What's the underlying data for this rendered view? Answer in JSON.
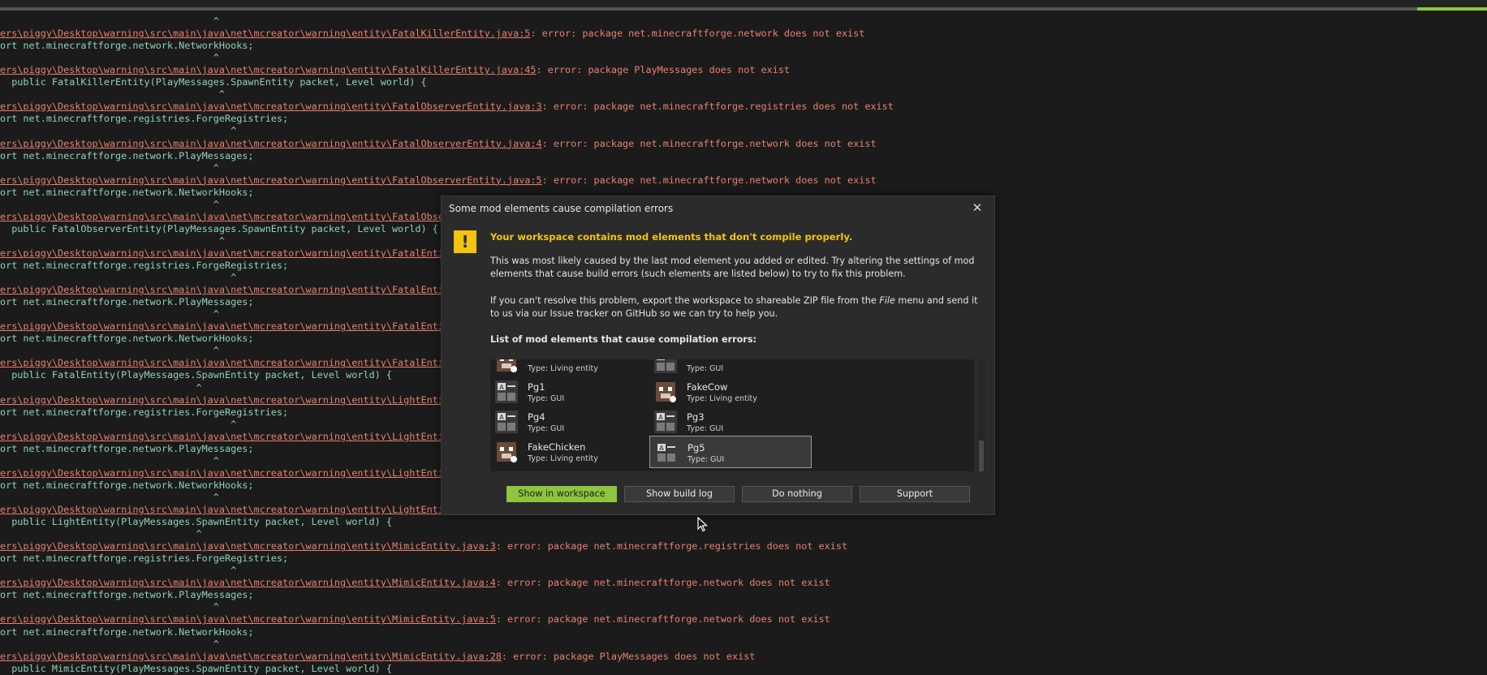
{
  "console": {
    "lines": [
      {
        "type": "caret",
        "text": "                                     ^"
      },
      {
        "type": "err",
        "path": "ers\\piggy\\Desktop\\warning\\src\\main\\java\\net\\mcreator\\warning\\entity\\FatalKillerEntity.java:5",
        "msg": ": error: package net.minecraftforge.network does not exist"
      },
      {
        "type": "code",
        "text": "ort net.minecraftforge.network.NetworkHooks;"
      },
      {
        "type": "caret",
        "text": "                                     ^"
      },
      {
        "type": "err",
        "path": "ers\\piggy\\Desktop\\warning\\src\\main\\java\\net\\mcreator\\warning\\entity\\FatalKillerEntity.java:45",
        "msg": ": error: package PlayMessages does not exist"
      },
      {
        "type": "code",
        "text": "  public FatalKillerEntity(PlayMessages.SpawnEntity packet, Level world) {"
      },
      {
        "type": "caret",
        "text": "                                      ^"
      },
      {
        "type": "err",
        "path": "ers\\piggy\\Desktop\\warning\\src\\main\\java\\net\\mcreator\\warning\\entity\\FatalObserverEntity.java:3",
        "msg": ": error: package net.minecraftforge.registries does not exist"
      },
      {
        "type": "code",
        "text": "ort net.minecraftforge.registries.ForgeRegistries;"
      },
      {
        "type": "caret",
        "text": "                                        ^"
      },
      {
        "type": "err",
        "path": "ers\\piggy\\Desktop\\warning\\src\\main\\java\\net\\mcreator\\warning\\entity\\FatalObserverEntity.java:4",
        "msg": ": error: package net.minecraftforge.network does not exist"
      },
      {
        "type": "code",
        "text": "ort net.minecraftforge.network.PlayMessages;"
      },
      {
        "type": "caret",
        "text": "                                     ^"
      },
      {
        "type": "err",
        "path": "ers\\piggy\\Desktop\\warning\\src\\main\\java\\net\\mcreator\\warning\\entity\\FatalObserverEntity.java:5",
        "msg": ": error: package net.minecraftforge.network does not exist"
      },
      {
        "type": "code",
        "text": "ort net.minecraftforge.network.NetworkHooks;"
      },
      {
        "type": "caret",
        "text": "                                     ^"
      },
      {
        "type": "err",
        "path": "ers\\piggy\\Desktop\\warning\\src\\main\\java\\net\\mcreator\\warning\\entity\\FatalObse",
        "msg": ""
      },
      {
        "type": "code",
        "text": "  public FatalObserverEntity(PlayMessages.SpawnEntity packet, Level world) {"
      },
      {
        "type": "caret",
        "text": "                                      ^"
      },
      {
        "type": "err",
        "path": "ers\\piggy\\Desktop\\warning\\src\\main\\java\\net\\mcreator\\warning\\entity\\FatalEnti",
        "msg": ""
      },
      {
        "type": "code",
        "text": "ort net.minecraftforge.registries.ForgeRegistries;"
      },
      {
        "type": "caret",
        "text": "                                        ^"
      },
      {
        "type": "err",
        "path": "ers\\piggy\\Desktop\\warning\\src\\main\\java\\net\\mcreator\\warning\\entity\\FatalEnti",
        "msg": ""
      },
      {
        "type": "code",
        "text": "ort net.minecraftforge.network.PlayMessages;"
      },
      {
        "type": "caret",
        "text": "                                     ^"
      },
      {
        "type": "err",
        "path": "ers\\piggy\\Desktop\\warning\\src\\main\\java\\net\\mcreator\\warning\\entity\\FatalEnti",
        "msg": ""
      },
      {
        "type": "code",
        "text": "ort net.minecraftforge.network.NetworkHooks;"
      },
      {
        "type": "caret",
        "text": "                                     ^"
      },
      {
        "type": "err",
        "path": "ers\\piggy\\Desktop\\warning\\src\\main\\java\\net\\mcreator\\warning\\entity\\FatalEnti",
        "msg": ""
      },
      {
        "type": "code",
        "text": "  public FatalEntity(PlayMessages.SpawnEntity packet, Level world) {"
      },
      {
        "type": "caret",
        "text": "                                  ^"
      },
      {
        "type": "err",
        "path": "ers\\piggy\\Desktop\\warning\\src\\main\\java\\net\\mcreator\\warning\\entity\\LightEnti",
        "msg": ""
      },
      {
        "type": "code",
        "text": "ort net.minecraftforge.registries.ForgeRegistries;"
      },
      {
        "type": "caret",
        "text": "                                        ^"
      },
      {
        "type": "err",
        "path": "ers\\piggy\\Desktop\\warning\\src\\main\\java\\net\\mcreator\\warning\\entity\\LightEnti",
        "msg": ""
      },
      {
        "type": "code",
        "text": "ort net.minecraftforge.network.PlayMessages;"
      },
      {
        "type": "caret",
        "text": "                                     ^"
      },
      {
        "type": "err",
        "path": "ers\\piggy\\Desktop\\warning\\src\\main\\java\\net\\mcreator\\warning\\entity\\LightEnti",
        "msg": ""
      },
      {
        "type": "code",
        "text": "ort net.minecraftforge.network.NetworkHooks;"
      },
      {
        "type": "caret",
        "text": "                                     ^"
      },
      {
        "type": "err",
        "path": "ers\\piggy\\Desktop\\warning\\src\\main\\java\\net\\mcreator\\warning\\entity\\LightEnti",
        "msg": ""
      },
      {
        "type": "code",
        "text": "  public LightEntity(PlayMessages.SpawnEntity packet, Level world) {"
      },
      {
        "type": "caret",
        "text": "                                  ^"
      },
      {
        "type": "err",
        "path": "ers\\piggy\\Desktop\\warning\\src\\main\\java\\net\\mcreator\\warning\\entity\\MimicEntity.java:3",
        "msg": ": error: package net.minecraftforge.registries does not exist"
      },
      {
        "type": "code",
        "text": "ort net.minecraftforge.registries.ForgeRegistries;"
      },
      {
        "type": "caret",
        "text": "                                        ^"
      },
      {
        "type": "err",
        "path": "ers\\piggy\\Desktop\\warning\\src\\main\\java\\net\\mcreator\\warning\\entity\\MimicEntity.java:4",
        "msg": ": error: package net.minecraftforge.network does not exist"
      },
      {
        "type": "code",
        "text": "ort net.minecraftforge.network.PlayMessages;"
      },
      {
        "type": "caret",
        "text": "                                     ^"
      },
      {
        "type": "err",
        "path": "ers\\piggy\\Desktop\\warning\\src\\main\\java\\net\\mcreator\\warning\\entity\\MimicEntity.java:5",
        "msg": ": error: package net.minecraftforge.network does not exist"
      },
      {
        "type": "code",
        "text": "ort net.minecraftforge.network.NetworkHooks;"
      },
      {
        "type": "caret",
        "text": "                                     ^"
      },
      {
        "type": "err",
        "path": "ers\\piggy\\Desktop\\warning\\src\\main\\java\\net\\mcreator\\warning\\entity\\MimicEntity.java:28",
        "msg": ": error: package PlayMessages does not exist"
      },
      {
        "type": "code",
        "text": "  public MimicEntity(PlayMessages.SpawnEntity packet, Level world) {"
      }
    ]
  },
  "dialog": {
    "title": "Some mod elements cause compilation errors",
    "close_glyph": "✕",
    "warning_glyph": "!",
    "headline": "Your workspace contains mod elements that don't compile properly.",
    "para1": "This was most likely caused by the last mod element you added or edited. Try altering the settings of mod elements that cause build errors (such elements are listed below) to try to fix this problem.",
    "para2_before": "If you can't resolve this problem, export the workspace to shareable ZIP file from the ",
    "para2_em": "File",
    "para2_after": " menu and send it to us via our Issue tracker on GitHub so we can try to help you.",
    "list_title": "List of mod elements that cause compilation errors:",
    "elements": [
      {
        "name": "",
        "type": "Type: Living entity",
        "icon": "entity-icon"
      },
      {
        "name": "",
        "type": "Type: GUI",
        "icon": "gui-icon"
      },
      {
        "name": "Pg1",
        "type": "Type: GUI",
        "icon": "gui-icon"
      },
      {
        "name": "FakeCow",
        "type": "Type: Living entity",
        "icon": "entity-icon"
      },
      {
        "name": "Pg4",
        "type": "Type: GUI",
        "icon": "gui-icon"
      },
      {
        "name": "Pg3",
        "type": "Type: GUI",
        "icon": "gui-icon"
      },
      {
        "name": "FakeChicken",
        "type": "Type: Living entity",
        "icon": "entity-icon"
      },
      {
        "name": "Pg5",
        "type": "Type: GUI",
        "icon": "gui-icon",
        "selected": true
      }
    ],
    "buttons": {
      "show_in_workspace": "Show in workspace",
      "show_build_log": "Show build log",
      "do_nothing": "Do nothing",
      "support": "Support"
    }
  },
  "colors": {
    "accent": "#8cc63f",
    "warning": "#f2c40f",
    "error_text": "#e8806d",
    "code_text": "#8fd3b8"
  }
}
